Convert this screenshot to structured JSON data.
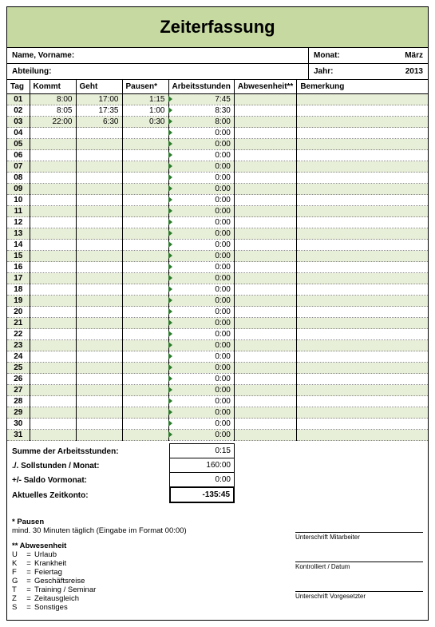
{
  "title": "Zeiterfassung",
  "meta": {
    "name_label": "Name, Vorname:",
    "dept_label": "Abteilung:",
    "month_label": "Monat:",
    "month_value": "März",
    "year_label": "Jahr:",
    "year_value": "2013"
  },
  "headers": {
    "tag": "Tag",
    "kommt": "Kommt",
    "geht": "Geht",
    "pausen": "Pausen*",
    "arbeit": "Arbeitsstunden",
    "abw": "Abwesenheit**",
    "bem": "Bemerkung"
  },
  "rows": [
    {
      "tag": "01",
      "kommt": "8:00",
      "geht": "17:00",
      "pausen": "1:15",
      "arbeit": "7:45"
    },
    {
      "tag": "02",
      "kommt": "8:05",
      "geht": "17:35",
      "pausen": "1:00",
      "arbeit": "8:30"
    },
    {
      "tag": "03",
      "kommt": "22:00",
      "geht": "6:30",
      "pausen": "0:30",
      "arbeit": "8:00"
    },
    {
      "tag": "04",
      "kommt": "",
      "geht": "",
      "pausen": "",
      "arbeit": "0:00"
    },
    {
      "tag": "05",
      "kommt": "",
      "geht": "",
      "pausen": "",
      "arbeit": "0:00"
    },
    {
      "tag": "06",
      "kommt": "",
      "geht": "",
      "pausen": "",
      "arbeit": "0:00"
    },
    {
      "tag": "07",
      "kommt": "",
      "geht": "",
      "pausen": "",
      "arbeit": "0:00"
    },
    {
      "tag": "08",
      "kommt": "",
      "geht": "",
      "pausen": "",
      "arbeit": "0:00"
    },
    {
      "tag": "09",
      "kommt": "",
      "geht": "",
      "pausen": "",
      "arbeit": "0:00"
    },
    {
      "tag": "10",
      "kommt": "",
      "geht": "",
      "pausen": "",
      "arbeit": "0:00"
    },
    {
      "tag": "11",
      "kommt": "",
      "geht": "",
      "pausen": "",
      "arbeit": "0:00"
    },
    {
      "tag": "12",
      "kommt": "",
      "geht": "",
      "pausen": "",
      "arbeit": "0:00"
    },
    {
      "tag": "13",
      "kommt": "",
      "geht": "",
      "pausen": "",
      "arbeit": "0:00"
    },
    {
      "tag": "14",
      "kommt": "",
      "geht": "",
      "pausen": "",
      "arbeit": "0:00"
    },
    {
      "tag": "15",
      "kommt": "",
      "geht": "",
      "pausen": "",
      "arbeit": "0:00"
    },
    {
      "tag": "16",
      "kommt": "",
      "geht": "",
      "pausen": "",
      "arbeit": "0:00"
    },
    {
      "tag": "17",
      "kommt": "",
      "geht": "",
      "pausen": "",
      "arbeit": "0:00"
    },
    {
      "tag": "18",
      "kommt": "",
      "geht": "",
      "pausen": "",
      "arbeit": "0:00"
    },
    {
      "tag": "19",
      "kommt": "",
      "geht": "",
      "pausen": "",
      "arbeit": "0:00"
    },
    {
      "tag": "20",
      "kommt": "",
      "geht": "",
      "pausen": "",
      "arbeit": "0:00"
    },
    {
      "tag": "21",
      "kommt": "",
      "geht": "",
      "pausen": "",
      "arbeit": "0:00"
    },
    {
      "tag": "22",
      "kommt": "",
      "geht": "",
      "pausen": "",
      "arbeit": "0:00"
    },
    {
      "tag": "23",
      "kommt": "",
      "geht": "",
      "pausen": "",
      "arbeit": "0:00"
    },
    {
      "tag": "24",
      "kommt": "",
      "geht": "",
      "pausen": "",
      "arbeit": "0:00"
    },
    {
      "tag": "25",
      "kommt": "",
      "geht": "",
      "pausen": "",
      "arbeit": "0:00"
    },
    {
      "tag": "26",
      "kommt": "",
      "geht": "",
      "pausen": "",
      "arbeit": "0:00"
    },
    {
      "tag": "27",
      "kommt": "",
      "geht": "",
      "pausen": "",
      "arbeit": "0:00"
    },
    {
      "tag": "28",
      "kommt": "",
      "geht": "",
      "pausen": "",
      "arbeit": "0:00"
    },
    {
      "tag": "29",
      "kommt": "",
      "geht": "",
      "pausen": "",
      "arbeit": "0:00"
    },
    {
      "tag": "30",
      "kommt": "",
      "geht": "",
      "pausen": "",
      "arbeit": "0:00"
    },
    {
      "tag": "31",
      "kommt": "",
      "geht": "",
      "pausen": "",
      "arbeit": "0:00"
    }
  ],
  "summary": {
    "sum_label": "Summe der Arbeitsstunden:",
    "sum_value": "0:15",
    "soll_label": "./. Sollstunden / Monat:",
    "soll_value": "160:00",
    "saldo_label": "+/- Saldo Vormonat:",
    "saldo_value": "0:00",
    "konto_label": "Aktuelles Zeitkonto:",
    "konto_value": "-135:45"
  },
  "footer": {
    "pausen_hdr": "* Pausen",
    "pausen_txt": "mind. 30 Minuten täglich (Eingabe im Format 00:00)",
    "abw_hdr": "** Abwesenheit",
    "legend": [
      {
        "k": "U",
        "v": "Urlaub"
      },
      {
        "k": "K",
        "v": "Krankheit"
      },
      {
        "k": "F",
        "v": "Feiertag"
      },
      {
        "k": "G",
        "v": "Geschäftsreise"
      },
      {
        "k": "T",
        "v": "Training / Seminar"
      },
      {
        "k": "Z",
        "v": "Zeitausgleich"
      },
      {
        "k": "S",
        "v": "Sonstiges"
      }
    ],
    "sig1": "Unterschrift Mitarbeiter",
    "sig2": "Kontrolliert / Datum",
    "sig3": "Unterschrift Vorgesetzter"
  }
}
